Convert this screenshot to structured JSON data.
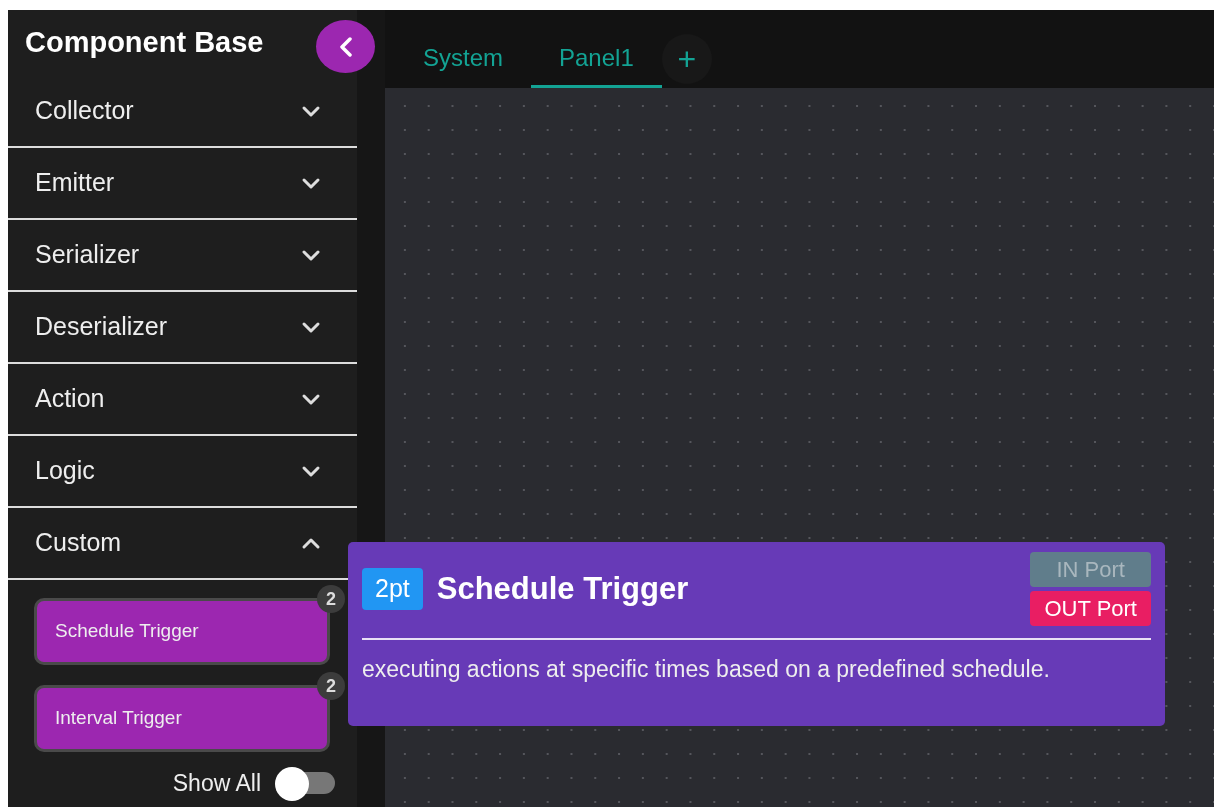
{
  "sidebar": {
    "title": "Component Base",
    "categories": [
      {
        "label": "Collector",
        "expanded": false
      },
      {
        "label": "Emitter",
        "expanded": false
      },
      {
        "label": "Serializer",
        "expanded": false
      },
      {
        "label": "Deserializer",
        "expanded": false
      },
      {
        "label": "Action",
        "expanded": false
      },
      {
        "label": "Logic",
        "expanded": false
      },
      {
        "label": "Custom",
        "expanded": true,
        "items": [
          {
            "label": "Schedule Trigger",
            "count": "2"
          },
          {
            "label": "Interval Trigger",
            "count": "2"
          }
        ]
      }
    ],
    "show_all": {
      "label": "Show All",
      "on": false
    }
  },
  "tabs": [
    {
      "label": "System",
      "selected": false
    },
    {
      "label": "Panel1",
      "selected": true
    }
  ],
  "add_tab": "+",
  "tooltip": {
    "badge": "2pt",
    "title": "Schedule Trigger",
    "ports": [
      {
        "label": "IN Port",
        "kind": "in"
      },
      {
        "label": "OUT Port",
        "kind": "out"
      }
    ],
    "description": "executing actions at specific times based on a predefined schedule."
  }
}
